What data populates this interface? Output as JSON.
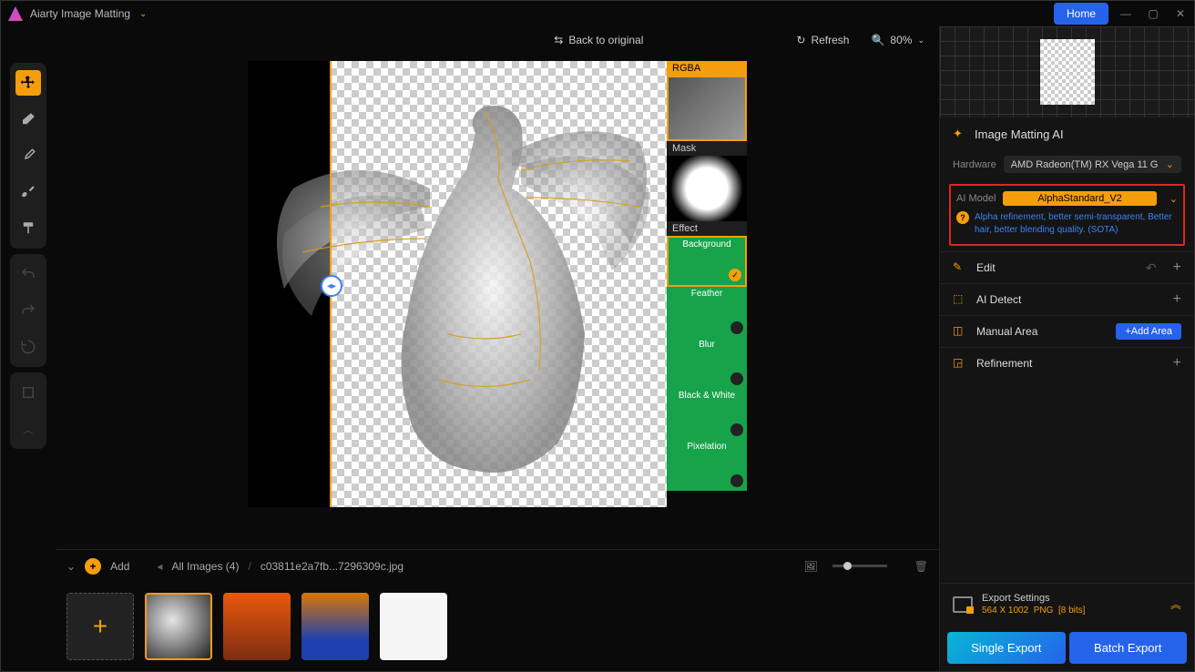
{
  "titlebar": {
    "app_name": "Aiarty Image Matting",
    "home": "Home"
  },
  "canvas_toolbar": {
    "back": "Back to original",
    "refresh": "Refresh",
    "zoom": "80%"
  },
  "previews": {
    "rgba": "RGBA",
    "mask": "Mask",
    "effect": "Effect"
  },
  "effects": [
    "Background",
    "Feather",
    "Blur",
    "Black & White",
    "Pixelation"
  ],
  "right": {
    "section_title": "Image Matting AI",
    "hardware_label": "Hardware",
    "hardware_value": "AMD Radeon(TM) RX Vega 11 G",
    "model_label": "AI Model",
    "model_value": "AlphaStandard_V2",
    "model_desc": "Alpha refinement, better semi-transparent, Better hair, better blending quality. (SOTA)",
    "edit": "Edit",
    "ai_detect": "AI Detect",
    "manual_area": "Manual Area",
    "add_area": "+Add Area",
    "refinement": "Refinement"
  },
  "export": {
    "title": "Export Settings",
    "dims": "564 X 1002",
    "format": "PNG",
    "bits": "[8 bits]",
    "single": "Single Export",
    "batch": "Batch Export"
  },
  "bottom": {
    "add": "Add",
    "all_images": "All Images (4)",
    "filename": "c03811e2a7fb...7296309c.jpg"
  }
}
